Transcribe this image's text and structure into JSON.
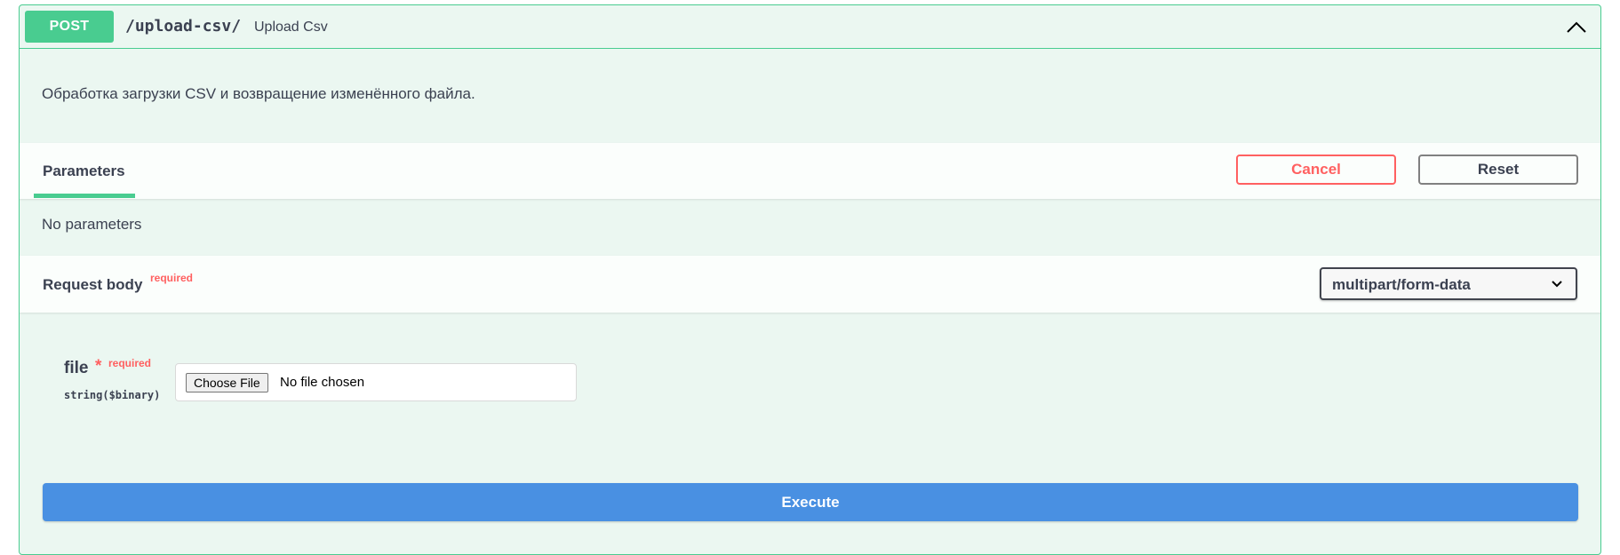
{
  "operation": {
    "method": "POST",
    "path": "/upload-csv/",
    "summary": "Upload Csv",
    "description": "Обработка загрузки CSV и возвращение изменённого файла.",
    "collapse_icon": "chevron-up-icon"
  },
  "parameters": {
    "tab_label": "Parameters",
    "cancel_label": "Cancel",
    "reset_label": "Reset",
    "empty_text": "No parameters"
  },
  "request_body": {
    "title": "Request body",
    "required_label": "required",
    "content_type": "multipart/form-data",
    "fields": [
      {
        "name": "file",
        "asterisk": "*",
        "required_label": "required",
        "type": "string($binary)",
        "choose_label": "Choose File",
        "status": "No file chosen"
      }
    ]
  },
  "execute_label": "Execute",
  "colors": {
    "post_green": "#49cc90",
    "block_bg": "#ebf7f1",
    "cancel_red": "#ff6060",
    "execute_blue": "#4990e2",
    "text": "#3b4151"
  }
}
